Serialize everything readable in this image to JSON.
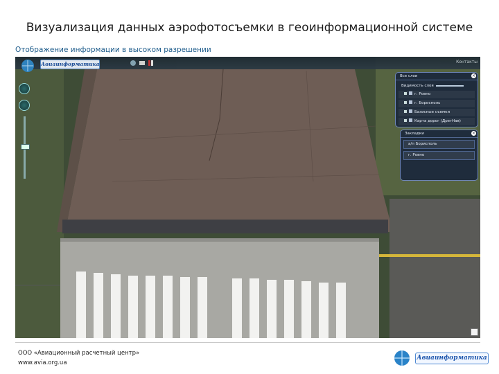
{
  "slide": {
    "title": "Визуализация данных аэрофотосъемки в геоинформационной системе",
    "subtitle": "Отображение информации в высоком разрешении"
  },
  "app": {
    "logo_text": "Авиаинформатика",
    "contacts": "Контакты",
    "layers_panel": {
      "title": "Все слои",
      "opacity_label": "Видимость слоя",
      "items": [
        {
          "label": "г. Ровно"
        },
        {
          "label": "г. Борисполь"
        },
        {
          "label": "Базисные съемки"
        },
        {
          "label": "Карта дорог (ДрегНав)"
        }
      ]
    },
    "bookmarks_panel": {
      "title": "Закладки",
      "items": [
        {
          "label": "а/п Борисполь"
        },
        {
          "label": "г. Ровно"
        }
      ]
    }
  },
  "footer": {
    "company": "ООО «Авиационный расчетный центр»",
    "site": "www.avia.org.ua",
    "logo_text": "Авиаинформатика"
  }
}
